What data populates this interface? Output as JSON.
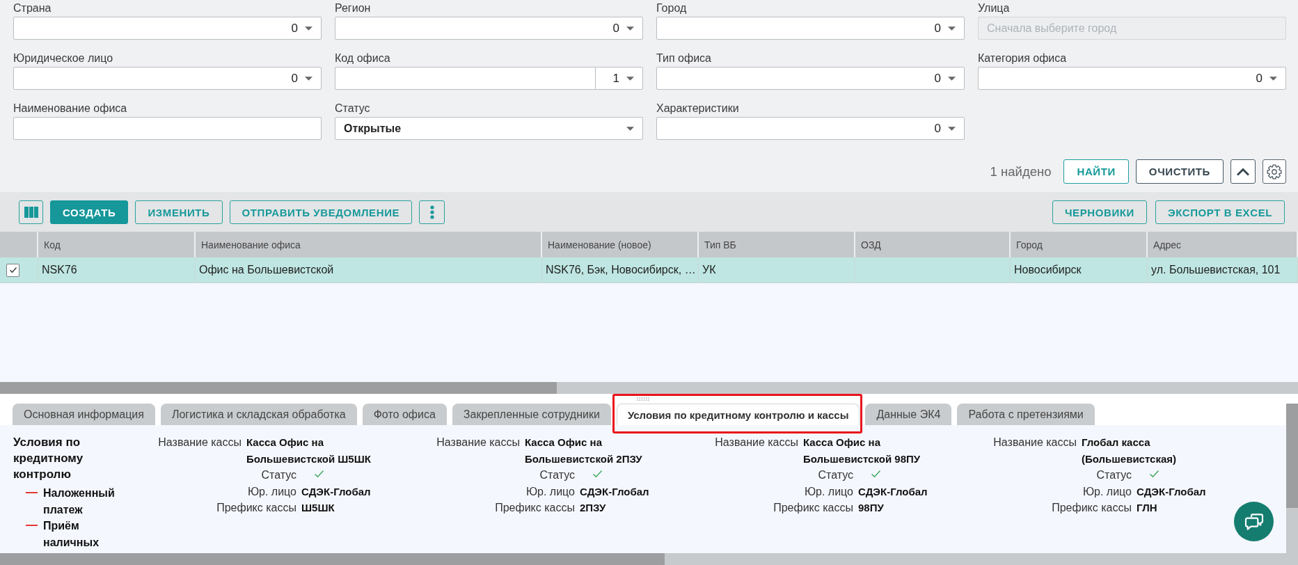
{
  "filters": {
    "fields": [
      {
        "label": "Страна",
        "kind": "multiselect",
        "count": "0"
      },
      {
        "label": "Регион",
        "kind": "multiselect",
        "count": "0"
      },
      {
        "label": "Город",
        "kind": "multiselect",
        "count": "0"
      },
      {
        "label": "Улица",
        "kind": "text",
        "disabled": true,
        "placeholder": "Сначала выберите город"
      },
      {
        "label": "Юридическое лицо",
        "kind": "multiselect",
        "count": "0"
      },
      {
        "label": "Код офиса",
        "kind": "split",
        "count": "1"
      },
      {
        "label": "Тип офиса",
        "kind": "multiselect",
        "count": "0"
      },
      {
        "label": "Категория офиса",
        "kind": "multiselect",
        "count": "0"
      },
      {
        "label": "Наименование офиса",
        "kind": "text",
        "disabled": false
      },
      {
        "label": "Статус",
        "kind": "select",
        "value": "Открытые"
      },
      {
        "label": "Характеристики",
        "kind": "multiselect",
        "count": "0"
      }
    ],
    "result": "1 найдено",
    "buttons": [
      {
        "kind": "accent",
        "label": "НАЙТИ"
      },
      {
        "kind": "neutral",
        "label": "ОЧИСТИТЬ"
      },
      {
        "kind": "collapse"
      },
      {
        "kind": "settings"
      }
    ]
  },
  "toolbar": {
    "left": [
      {
        "kind": "columns"
      },
      {
        "kind": "primary",
        "label": "СОЗДАТЬ"
      },
      {
        "kind": "outline",
        "label": "ИЗМЕНИТЬ"
      },
      {
        "kind": "outline",
        "label": "ОТПРАВИТЬ УВЕДОМЛЕНИЕ"
      },
      {
        "kind": "more"
      }
    ],
    "right": [
      {
        "kind": "outline",
        "label": "ЧЕРНОВИКИ"
      },
      {
        "kind": "outline",
        "label": "ЭКСПОРТ В EXCEL"
      }
    ]
  },
  "table": {
    "columns": [
      "Код",
      "Наименование офиса",
      "Наименование (новое)",
      "Тип ВБ",
      "ОЗД",
      "Город",
      "Адрес"
    ],
    "rows": [
      {
        "selected": true,
        "checked": true,
        "cells": [
          "NSK76",
          "Офис на Большевистской",
          "NSK76, Бэк, Новосибирск, …",
          "УК",
          null,
          "Новосибирск",
          "ул. Большевистская, 101"
        ]
      }
    ]
  },
  "detail_tabs": [
    {
      "label": "Основная информация",
      "selected": false,
      "highlighted": false
    },
    {
      "label": "Логистика и складская обработка",
      "selected": false,
      "highlighted": false
    },
    {
      "label": "Фото офиса",
      "selected": false,
      "highlighted": false
    },
    {
      "label": "Закрепленные сотрудники",
      "selected": false,
      "highlighted": false
    },
    {
      "label": "Условия по кредитному контролю и кассы",
      "selected": true,
      "highlighted": true
    },
    {
      "label": "Данные ЭК4",
      "selected": false,
      "highlighted": false
    },
    {
      "label": "Работа с претензиями",
      "selected": false,
      "highlighted": false
    }
  ],
  "credit_control": {
    "title": "Условия по кредитному контролю",
    "items": [
      {
        "label": "Наложенный платеж",
        "allowed": false
      },
      {
        "label": "Приём наличных",
        "allowed": false
      }
    ]
  },
  "cash_registers": [
    {
      "name_label": "Название кассы",
      "name": "Касса Офис на Большевистской Ш5ШК",
      "status_label": "Статус",
      "active": true,
      "entity_label": "Юр. лицо",
      "entity": "СДЭК-Глобал",
      "prefix_label": "Префикс кассы",
      "prefix": "Ш5ШК"
    },
    {
      "name_label": "Название кассы",
      "name": "Касса Офис на Большевистской 2ПЗУ",
      "status_label": "Статус",
      "active": true,
      "entity_label": "Юр. лицо",
      "entity": "СДЭК-Глобал",
      "prefix_label": "Префикс кассы",
      "prefix": "2ПЗУ"
    },
    {
      "name_label": "Название кассы",
      "name": "Касса Офис на Большевистской 98ПУ",
      "status_label": "Статус",
      "active": true,
      "entity_label": "Юр. лицо",
      "entity": "СДЭК-Глобал",
      "prefix_label": "Префикс кассы",
      "prefix": "98ПУ"
    },
    {
      "name_label": "Название кассы",
      "name": "Глобал касса (Большевистская)",
      "status_label": "Статус",
      "active": true,
      "entity_label": "Юр. лицо",
      "entity": "СДЭК-Глобал",
      "prefix_label": "Префикс кассы",
      "prefix": "ГЛН"
    }
  ]
}
